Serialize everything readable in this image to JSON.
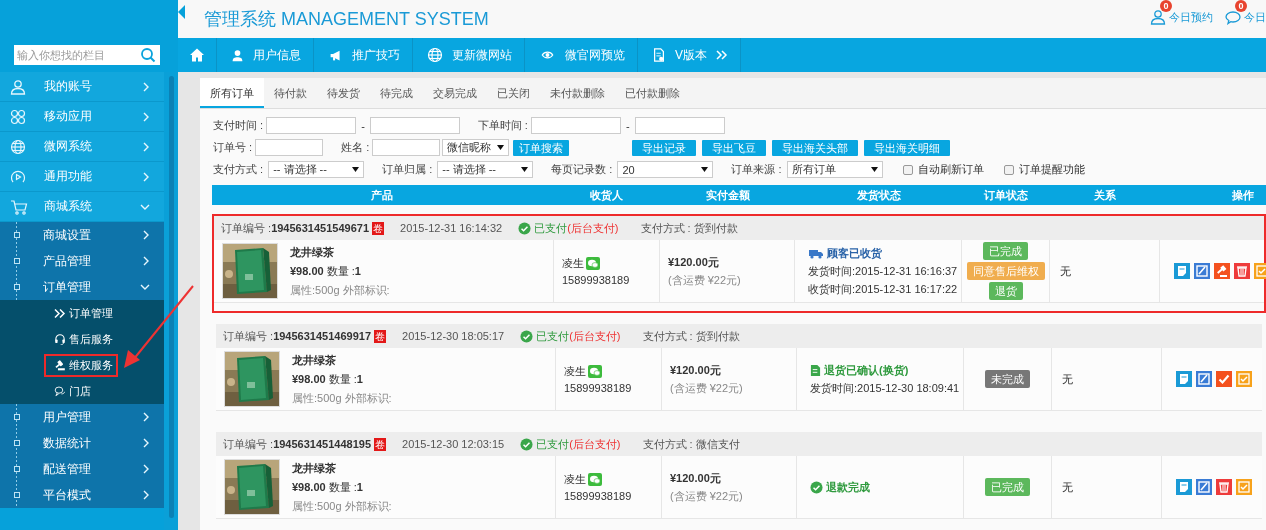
{
  "header": {
    "title": "管理系统 MANAGEMENT SYSTEM",
    "links": [
      {
        "label": "今日预约",
        "count": "0"
      },
      {
        "label": "今日",
        "count": "0"
      }
    ]
  },
  "sidebar": {
    "search": {
      "placeholder": "输入你想找的栏目"
    },
    "items": [
      {
        "label": "我的账号",
        "expanded": false
      },
      {
        "label": "移动应用",
        "expanded": false
      },
      {
        "label": "微网系统",
        "expanded": false
      },
      {
        "label": "通用功能",
        "expanded": false
      },
      {
        "label": "商城系统",
        "expanded": true,
        "children": [
          {
            "label": "商城设置",
            "expanded": false
          },
          {
            "label": "产品管理",
            "expanded": false
          },
          {
            "label": "订单管理",
            "expanded": true,
            "children": [
              {
                "label": "订单管理",
                "highlighted": false
              },
              {
                "label": "售后服务",
                "highlighted": false
              },
              {
                "label": "维权服务",
                "highlighted": true
              },
              {
                "label": "门店",
                "highlighted": false
              }
            ]
          },
          {
            "label": "用户管理",
            "expanded": false
          },
          {
            "label": "数据统计",
            "expanded": false
          },
          {
            "label": "配送管理",
            "expanded": false
          },
          {
            "label": "平台模式",
            "expanded": false
          }
        ]
      }
    ]
  },
  "nav": [
    "用户信息",
    "推广技巧",
    "更新微网站",
    "微官网预览",
    "V版本"
  ],
  "tabs": [
    {
      "label": "所有订单",
      "selected": true
    },
    {
      "label": "待付款",
      "selected": false
    },
    {
      "label": "待发货",
      "selected": false
    },
    {
      "label": "待完成",
      "selected": false
    },
    {
      "label": "交易完成",
      "selected": false
    },
    {
      "label": "已关闭",
      "selected": false
    },
    {
      "label": "未付款删除",
      "selected": false
    },
    {
      "label": "已付款删除",
      "selected": false
    }
  ],
  "filter_rows": [
    [
      {
        "kind": "label",
        "text": "支付时间 :"
      },
      {
        "kind": "input"
      },
      {
        "kind": "dash",
        "text": "-"
      },
      {
        "kind": "input"
      },
      {
        "kind": "label",
        "text": "下单时间 :"
      },
      {
        "kind": "input"
      },
      {
        "kind": "dash",
        "text": "-"
      },
      {
        "kind": "input"
      }
    ],
    [
      {
        "kind": "label",
        "text": "订单号 :"
      },
      {
        "kind": "input"
      },
      {
        "kind": "label",
        "text": "姓名 :"
      },
      {
        "kind": "input"
      },
      {
        "kind": "select",
        "value": "微信昵称"
      },
      {
        "kind": "button",
        "text": "订单搜索"
      },
      {
        "kind": "export",
        "text": "导出记录"
      },
      {
        "kind": "export",
        "text": "导出飞豆"
      },
      {
        "kind": "export",
        "text": "导出海关头部"
      },
      {
        "kind": "export",
        "text": "导出海关明细"
      }
    ],
    [
      {
        "kind": "label",
        "text": "支付方式 :"
      },
      {
        "kind": "select",
        "value": "-- 请选择 --"
      },
      {
        "kind": "label",
        "text": "订单归属 :"
      },
      {
        "kind": "select",
        "value": "-- 请选择 --"
      },
      {
        "kind": "label",
        "text": "每页记录数 :"
      },
      {
        "kind": "select",
        "value": "20"
      },
      {
        "kind": "label",
        "text": "订单来源 :"
      },
      {
        "kind": "select",
        "value": "所有订单"
      },
      {
        "kind": "checkbox",
        "text": "自动刷新订单",
        "checked": false
      },
      {
        "kind": "checkbox",
        "text": "订单提醒功能",
        "checked": false
      }
    ]
  ],
  "table": {
    "columns": [
      "产品",
      "收货人",
      "实付金额",
      "发货状态",
      "订单状态",
      "关系",
      "操作"
    ],
    "orders": [
      {
        "highlighted": true,
        "order_no_label": "订单编号 :",
        "order_no": "1945631451549671",
        "tag": "卷",
        "time": "2015-12-31 16:14:32",
        "paid": "已支付",
        "paid_note": "(后台支付)",
        "payment": "支付方式 : 货到付款",
        "product": {
          "name": "龙井绿茶",
          "price": "¥98.00",
          "qty_label": "数量 :",
          "qty": "1",
          "attrs": "属性:500g 外部标识:"
        },
        "receiver": {
          "name": "凌生",
          "phone": "15899938189"
        },
        "amount": "¥120.00元",
        "shipping_fee": "(含运费 ¥22元)",
        "shipping": {
          "kind": "received",
          "status": "顾客已收货",
          "lines": [
            "发货时间:2015-12-31 16:16:37",
            "收货时间:2015-12-31 16:17:22"
          ]
        },
        "status_buttons": [
          {
            "label": "已完成",
            "color": "#5cb85c"
          },
          {
            "label": "同意售后维权",
            "color": "#f0ad4e"
          },
          {
            "label": "退货",
            "color": "#5cb85c"
          }
        ],
        "relation": "无",
        "actions": [
          {
            "kind": "note"
          },
          {
            "kind": "edit"
          },
          {
            "kind": "gavel"
          },
          {
            "kind": "delete"
          },
          {
            "kind": "certificate"
          }
        ]
      },
      {
        "highlighted": false,
        "order_no_label": "订单编号 :",
        "order_no": "1945631451469917",
        "tag": "卷",
        "time": "2015-12-30 18:05:17",
        "paid": "已支付",
        "paid_note": "(后台支付)",
        "payment": "支付方式 : 货到付款",
        "product": {
          "name": "龙井绿茶",
          "price": "¥98.00",
          "qty_label": "数量 :",
          "qty": "1",
          "attrs": "属性:500g 外部标识:"
        },
        "receiver": {
          "name": "凌生",
          "phone": "15899938189"
        },
        "amount": "¥120.00元",
        "shipping_fee": "(含运费 ¥22元)",
        "shipping": {
          "kind": "returned",
          "status": "退货已确认(换货)",
          "lines": [
            "发货时间:2015-12-30 18:09:41"
          ]
        },
        "status_buttons": [
          {
            "label": "未完成",
            "color": "#777777"
          }
        ],
        "relation": "无",
        "actions": [
          {
            "kind": "note"
          },
          {
            "kind": "edit"
          },
          {
            "kind": "check"
          },
          {
            "kind": "certificate"
          }
        ]
      },
      {
        "highlighted": false,
        "order_no_label": "订单编号 :",
        "order_no": "1945631451448195",
        "tag": "卷",
        "time": "2015-12-30 12:03:15",
        "paid": "已支付",
        "paid_note": "(后台支付)",
        "payment": "支付方式 : 微信支付",
        "product": {
          "name": "龙井绿茶",
          "price": "¥98.00",
          "qty_label": "数量 :",
          "qty": "1",
          "attrs": "属性:500g 外部标识:"
        },
        "receiver": {
          "name": "凌生",
          "phone": "15899938189"
        },
        "amount": "¥120.00元",
        "shipping_fee": "(含运费 ¥22元)",
        "shipping": {
          "kind": "refunded",
          "status": "退款完成"
        },
        "status_buttons": [
          {
            "label": "已完成",
            "color": "#5cb85c"
          }
        ],
        "relation": "无",
        "actions": [
          {
            "kind": "note"
          },
          {
            "kind": "edit"
          },
          {
            "kind": "delete"
          },
          {
            "kind": "certificate"
          }
        ]
      }
    ]
  }
}
